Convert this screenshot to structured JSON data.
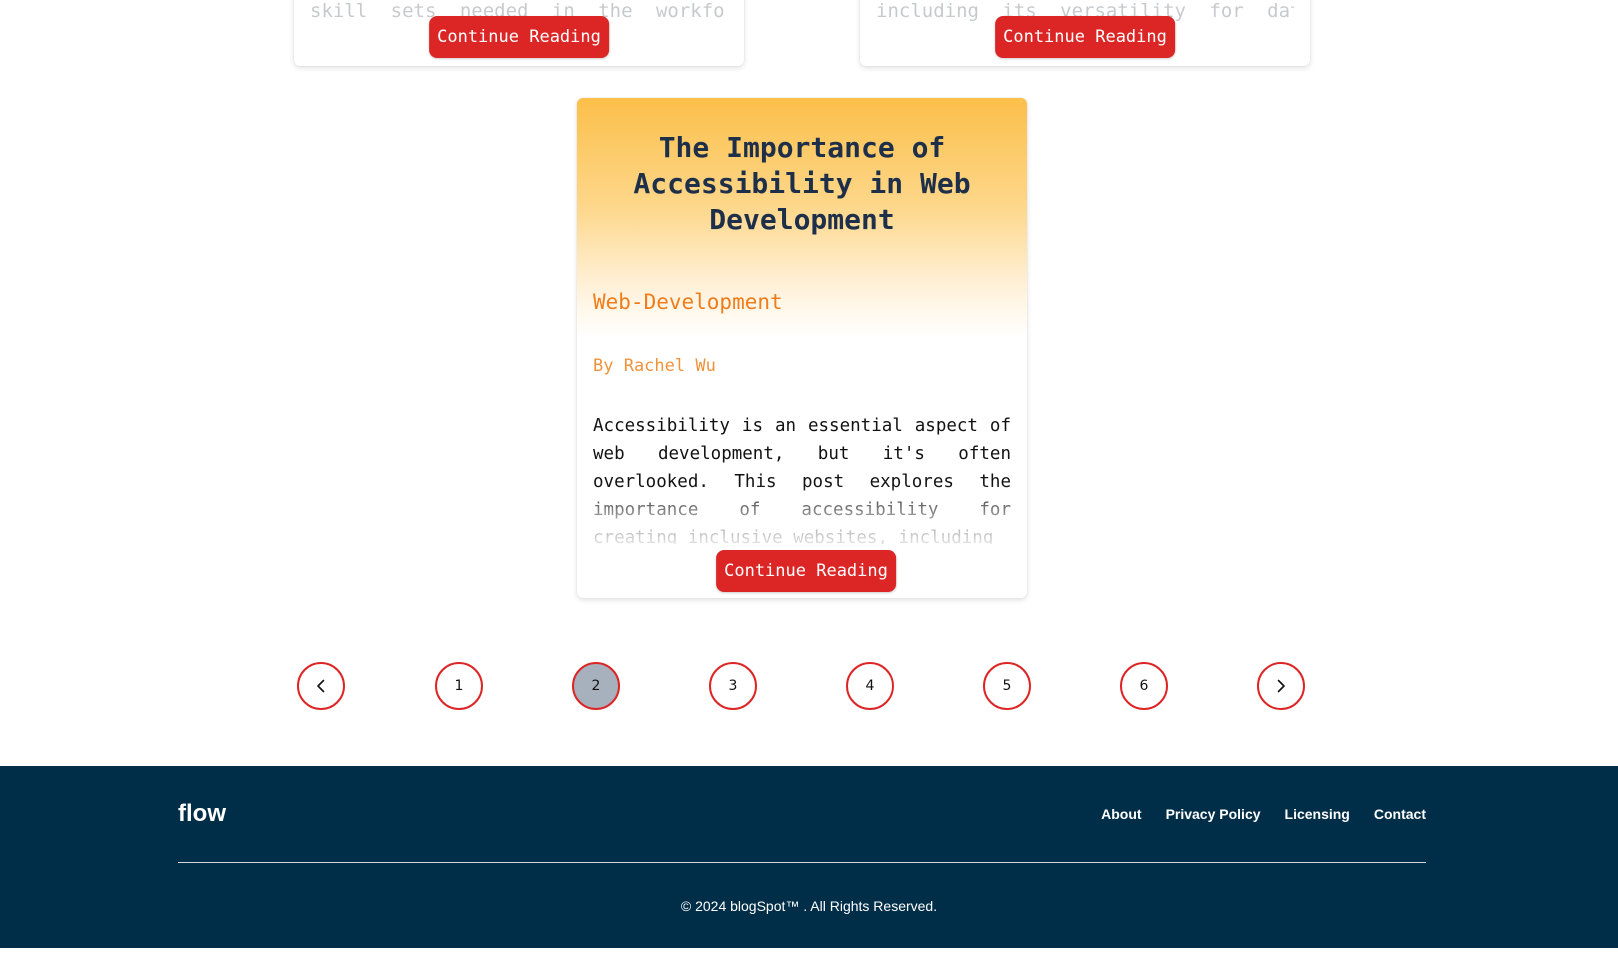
{
  "cards_top": [
    {
      "faded_text": "skill sets needed in the workforce,",
      "button_label": "Continue Reading"
    },
    {
      "faded_text": "including its versatility for data",
      "button_label": "Continue Reading"
    }
  ],
  "featured_post": {
    "title": "The Importance of Accessibility in Web Development",
    "category": "Web-Development",
    "author": "By Rachel Wu",
    "excerpt": "Accessibility is an essential aspect of web development, but it's often overlooked. This post explores the importance of accessibility for creating inclusive websites, including",
    "button_label": "Continue Reading"
  },
  "pagination": {
    "prev_icon": "chevron-left-icon",
    "next_icon": "chevron-right-icon",
    "pages": [
      "1",
      "2",
      "3",
      "4",
      "5",
      "6"
    ],
    "active_page": "2"
  },
  "footer": {
    "brand": "flow",
    "links": [
      "About",
      "Privacy Policy",
      "Licensing",
      "Contact"
    ],
    "copyright": "© 2024 blogSpot™ . All Rights Reserved."
  },
  "colors": {
    "accent_red": "#dc2626",
    "footer_bg": "#002d47",
    "active_page_bg": "#a6b1bd",
    "category_orange": "#f07d1a"
  }
}
